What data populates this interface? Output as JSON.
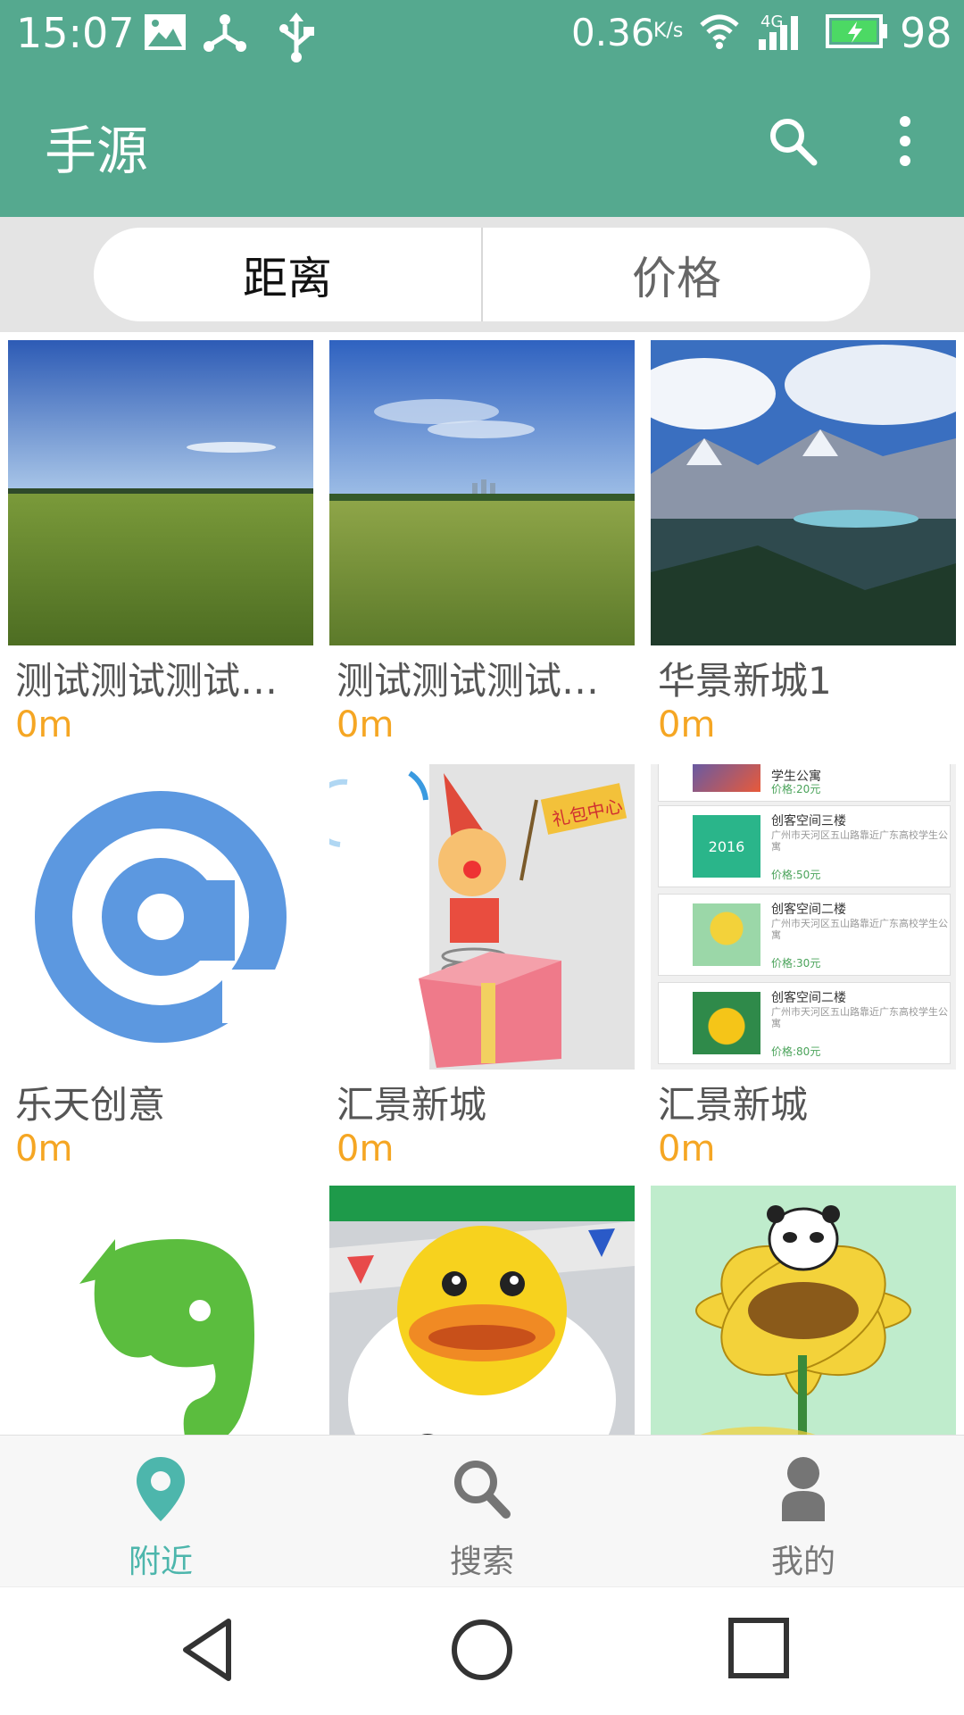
{
  "status_bar": {
    "time": "15:07",
    "speed": "0.36",
    "speed_unit": "K/s",
    "network": "4G",
    "battery": "98"
  },
  "app_bar": {
    "title": "手源"
  },
  "sort_tabs": [
    {
      "label": "距离"
    },
    {
      "label": "价格"
    }
  ],
  "grid_items": [
    {
      "name": "测试测试测试测试测试",
      "distance": "0m"
    },
    {
      "name": "测试测试测试测试测试",
      "distance": "0m"
    },
    {
      "name": "华景新城1",
      "distance": "0m"
    },
    {
      "name": "乐天创意",
      "distance": "0m"
    },
    {
      "name": "汇景新城",
      "distance": "0m"
    },
    {
      "name": "汇景新城",
      "distance": "0m"
    }
  ],
  "gift_banner": "礼包中心",
  "screenshot_list": [
    {
      "title": "学生公寓",
      "subtitle": "",
      "price": "价格:20元"
    },
    {
      "title": "创客空间三楼",
      "subtitle": "广州市天河区五山路靠近广东高校学生公寓",
      "price": "价格:50元",
      "thumb_text": "2016"
    },
    {
      "title": "创客空间二楼",
      "subtitle": "广州市天河区五山路靠近广东高校学生公寓",
      "price": "价格:30元"
    },
    {
      "title": "创客空间二楼",
      "subtitle": "广州市天河区五山路靠近广东高校学生公寓",
      "price": "价格:80元"
    }
  ],
  "bottom_nav": [
    {
      "label": "附近",
      "icon": "location-pin-icon",
      "active": true
    },
    {
      "label": "搜索",
      "icon": "search-icon",
      "active": false
    },
    {
      "label": "我的",
      "icon": "person-icon",
      "active": false
    }
  ],
  "colors": {
    "primary": "#55a98f",
    "distance": "#f5a623",
    "active_nav": "#4db6ac"
  }
}
